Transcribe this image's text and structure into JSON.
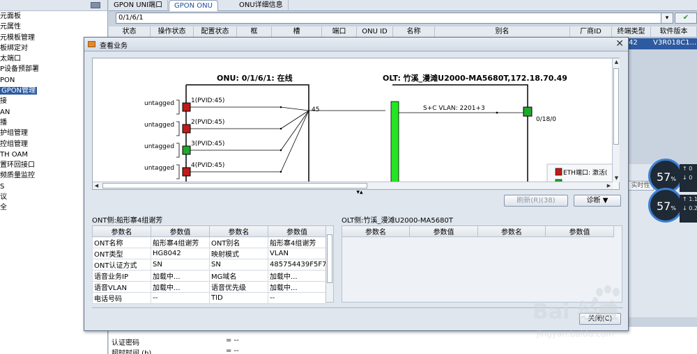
{
  "tree": {
    "items": [
      "元面板",
      "元属性",
      "元模板管理",
      "板绑定对",
      "太端口",
      "P设备预部署",
      "PON",
      "GPON管理",
      "接",
      "AN",
      "播",
      "护组管理",
      "控组管理",
      "TH OAM",
      "置环回接口",
      "频质量监控",
      "S",
      "议",
      "全"
    ],
    "selected_index": 7
  },
  "tabs": [
    "GPON UNI端口",
    "GPON ONU",
    "ONU详细信息"
  ],
  "path": "0/1/6/1",
  "grid": {
    "columns": [
      "状态",
      "操作状态",
      "配置状态",
      "框",
      "槽",
      "端口",
      "ONU ID",
      "名称",
      "别名",
      "厂商ID",
      "终端类型",
      "软件版本"
    ],
    "row": {
      "col_a": "42",
      "col_b": "V3R018C1..."
    }
  },
  "bg_fields": [
    {
      "label": "认证密码",
      "value": "= --"
    },
    {
      "label": "超时时间 (h)",
      "value": "= --"
    }
  ],
  "bg_right": {
    "realtime": "实时性",
    "g2": "1.1",
    "g3": "0.2"
  },
  "gauge": {
    "value": "57",
    "unit": "%",
    "up": "0",
    "down": "0"
  },
  "dialog": {
    "title": "查看业务",
    "onu_label": "ONU: 0/1/6/1: 在线",
    "olt_label": "OLT: 竹溪_漫滩U2000-MA5680T,172.18.70.49",
    "ports": [
      {
        "tag": "untagged",
        "label": "1(PVID:45)",
        "color": "#c21a1a"
      },
      {
        "tag": "untagged",
        "label": "2(PVID:45)",
        "color": "#c21a1a"
      },
      {
        "tag": "untagged",
        "label": "3(PVID:45)",
        "color": "#1fa82b"
      },
      {
        "tag": "untagged",
        "label": "4(PVID:45)",
        "color": "#c21a1a"
      }
    ],
    "vlan_tag": "45",
    "sc_vlan": "S+C VLAN: 2201+3",
    "olt_port": "0/18/0",
    "legend_text": "ETH端口: 激活(",
    "refresh_btn": "刷新(R)(38)",
    "diag_btn": "诊断 ▼",
    "ont_side": "ONT侧:船形寨4组谢芳",
    "olt_side": "OLT侧:竹溪_漫滩U2000-MA5680T",
    "table_headers": [
      "参数名",
      "参数值",
      "参数名",
      "参数值"
    ],
    "ont_rows": [
      [
        "ONT名称",
        "船形寨4组谢芳",
        "ONT别名",
        "船形寨4组谢芳"
      ],
      [
        "ONT类型",
        "HG8042",
        "映射模式",
        "VLAN"
      ],
      [
        "ONT认证方式",
        "SN",
        "SN",
        "485754439F5F7..."
      ],
      [
        "语音业务IP",
        "加载中...",
        "MG域名",
        "加载中..."
      ],
      [
        "语音VLAN",
        "加载中...",
        "语音优先级",
        "加载中..."
      ],
      [
        "电话号码",
        "--",
        "TID",
        "--"
      ]
    ],
    "close_btn": "关闭(C)"
  },
  "watermark": {
    "brand": "Bai 经验",
    "url": "jingyan.baidu.com"
  },
  "colors": {
    "accent": "#2d5aa0",
    "green": "#1fa82b",
    "red": "#c21a1a",
    "pon_bar": "#22e622"
  }
}
